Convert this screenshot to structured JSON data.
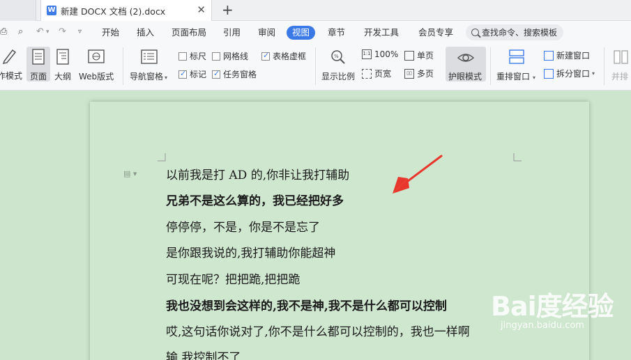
{
  "tabbar": {
    "doc_icon": "W",
    "doc_title": "新建 DOCX 文档 (2).docx",
    "close": "✕",
    "add": "+"
  },
  "menubar": {
    "items": [
      "开始",
      "插入",
      "页面布局",
      "引用",
      "审阅",
      "视图",
      "章节",
      "开发工具",
      "会员专享"
    ],
    "active": "视图",
    "search_placeholder": "查找命令、搜索模板"
  },
  "ribbon": {
    "write_mode": "作模式",
    "page": "页面",
    "outline": "大纲",
    "web": "Web版式",
    "nav_pane": "导航窗格",
    "ruler": "标尺",
    "grid": "网格线",
    "table_border": "表格虚框",
    "mark": "标记",
    "task_pane": "任务窗格",
    "zoom": "显示比例",
    "zoom100": "100%",
    "page_width": "页宽",
    "single_page": "单页",
    "multi_page": "多页",
    "eye_mode": "护眼模式",
    "rearrange": "重排窗口",
    "new_window": "新建窗口",
    "split_window": "拆分窗口",
    "side_by_side": "并排"
  },
  "document": {
    "lines": [
      {
        "text": "以前我是打 AD 的,你非让我打辅助",
        "bold": false
      },
      {
        "text": "兄弟不是这么算的，我已经把好多",
        "bold": true
      },
      {
        "text": "停停停，不是，你是不是忘了",
        "bold": false
      },
      {
        "text": "是你跟我说的,我打辅助你能超神",
        "bold": false
      },
      {
        "text": "可现在呢？把把跪,把把跪",
        "bold": false
      },
      {
        "text": "我也没想到会这样的,我不是神,我不是什么都可以控制",
        "bold": true
      },
      {
        "text": "哎,这句话你说对了,你不是什么都可以控制的，我也一样啊",
        "bold": false
      },
      {
        "text": "输,我控制不了",
        "bold": false
      }
    ]
  },
  "watermark": {
    "logo": "Bai度经验",
    "url": "jingyan.baidu.com"
  },
  "colors": {
    "accent": "#3b7ae6",
    "eye_green": "#cde5cd",
    "arrow": "#e8372c"
  }
}
